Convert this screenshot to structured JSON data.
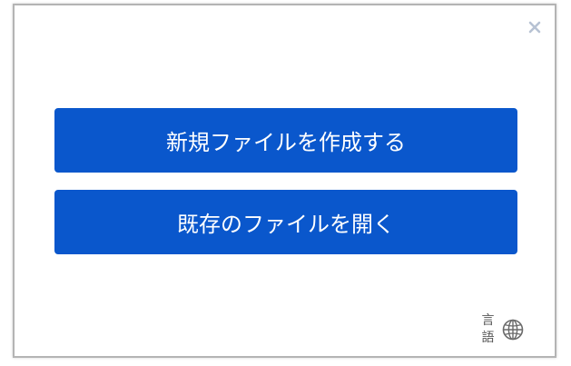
{
  "dialog": {
    "new_file_label": "新規ファイルを作成する",
    "open_file_label": "既存のファイルを開く",
    "language_label": "言語"
  },
  "icons": {
    "close": "close-icon",
    "language": "globe-icon"
  },
  "colors": {
    "primary": "#0a57cc",
    "close_icon": "#b7c2d3",
    "globe_icon": "#6a6a6a"
  }
}
